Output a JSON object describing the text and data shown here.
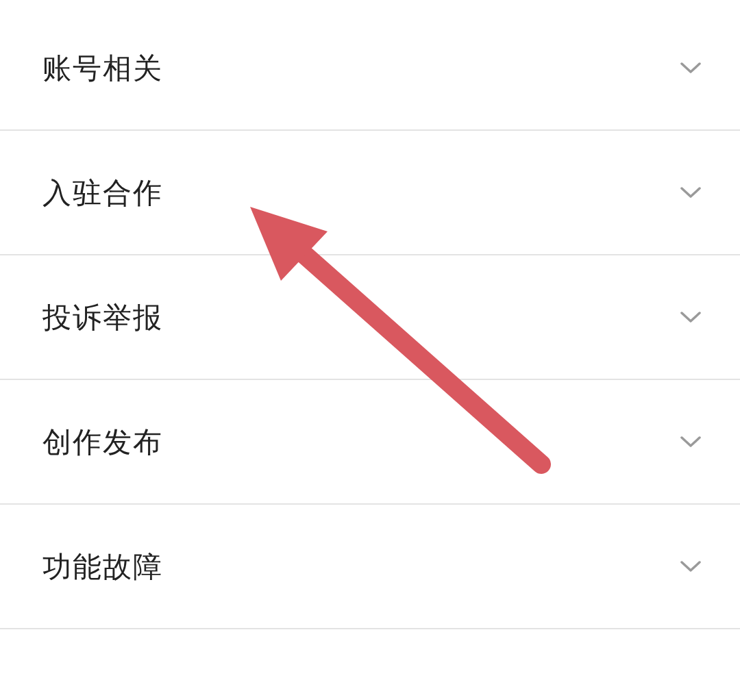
{
  "faq_categories": [
    {
      "label": "账号相关",
      "expanded": false
    },
    {
      "label": "入驻合作",
      "expanded": false
    },
    {
      "label": "投诉举报",
      "expanded": false
    },
    {
      "label": "创作发布",
      "expanded": false
    },
    {
      "label": "功能故障",
      "expanded": false
    }
  ]
}
